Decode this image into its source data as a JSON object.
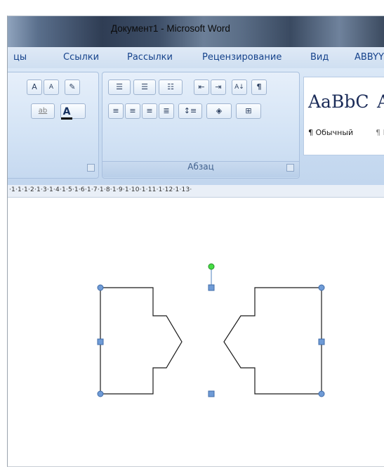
{
  "window": {
    "title": "Документ1 - Microsoft Word"
  },
  "ribbon": {
    "tabs": [
      "цы",
      "Ссылки",
      "Рассылки",
      "Рецензирование",
      "Вид",
      "ABBYY"
    ],
    "groups": {
      "paragraph_label": "Абзац"
    },
    "buttons": {
      "grow_font": "A",
      "shrink_font": "A",
      "highlight": "ab",
      "font_color": "A",
      "sort": "A↓",
      "show_marks": "¶"
    },
    "styles": {
      "sample": "AaBbC",
      "sample_partial": "A",
      "normal_name": "¶ Обычный",
      "next_name": "¶ I"
    }
  },
  "ruler": {
    "text": "·1·1·1·2·1·3·1·4·1·5·1·6·1·7·1·8·1·9·1·10·1·11·1·12·1·13·"
  },
  "colors": {
    "handle": "#4f81bd",
    "rotate_handle": "#22cc22"
  }
}
